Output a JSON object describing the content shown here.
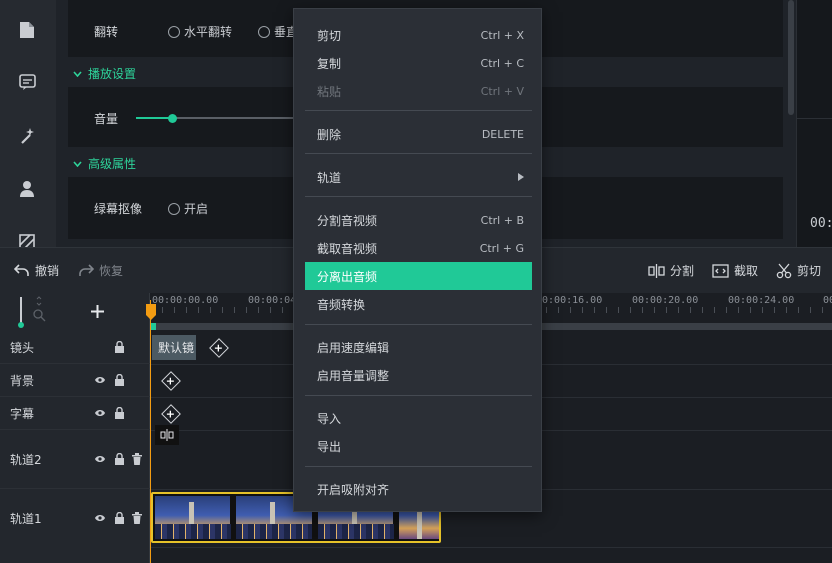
{
  "props": {
    "flip_label": "翻转",
    "flip_h": "水平翻转",
    "flip_v": "垂直",
    "playback_section": "播放设置",
    "volume_label": "音量",
    "advanced_section": "高级属性",
    "chroma_label": "绿幕抠像",
    "chroma_on": "开启"
  },
  "preview": {
    "time": "00:"
  },
  "toolbar": {
    "undo": "撤销",
    "redo": "恢复",
    "split": "分割",
    "crop": "截取",
    "cut": "剪切"
  },
  "ruler": {
    "ticks": [
      "00:00:00.00",
      "00:00:04.0",
      "00:00:16.00",
      "00:00:20.00",
      "00:00:24.00",
      "00"
    ]
  },
  "tracks": [
    {
      "name": "镜头"
    },
    {
      "name": "背景"
    },
    {
      "name": "字幕"
    },
    {
      "name": "轨道2"
    },
    {
      "name": "轨道1"
    }
  ],
  "clips": {
    "lens_clip": "默认镜"
  },
  "context_menu": {
    "items": [
      {
        "label": "剪切",
        "shortcut": "Ctrl + X"
      },
      {
        "label": "复制",
        "shortcut": "Ctrl + C"
      },
      {
        "label": "粘贴",
        "shortcut": "Ctrl + V"
      },
      {
        "label": "删除",
        "shortcut": "DELETE"
      },
      {
        "label": "轨道",
        "shortcut": ""
      },
      {
        "label": "分割音视频",
        "shortcut": "Ctrl + B"
      },
      {
        "label": "截取音视频",
        "shortcut": "Ctrl + G"
      },
      {
        "label": "分离出音频",
        "shortcut": ""
      },
      {
        "label": "音频转换",
        "shortcut": ""
      },
      {
        "label": "启用速度编辑",
        "shortcut": ""
      },
      {
        "label": "启用音量调整",
        "shortcut": ""
      },
      {
        "label": "导入",
        "shortcut": ""
      },
      {
        "label": "导出",
        "shortcut": ""
      },
      {
        "label": "开启吸附对齐",
        "shortcut": ""
      }
    ]
  },
  "colors": {
    "accent": "#20c997",
    "playhead": "#f39c12",
    "clip_border": "#e6c229"
  }
}
